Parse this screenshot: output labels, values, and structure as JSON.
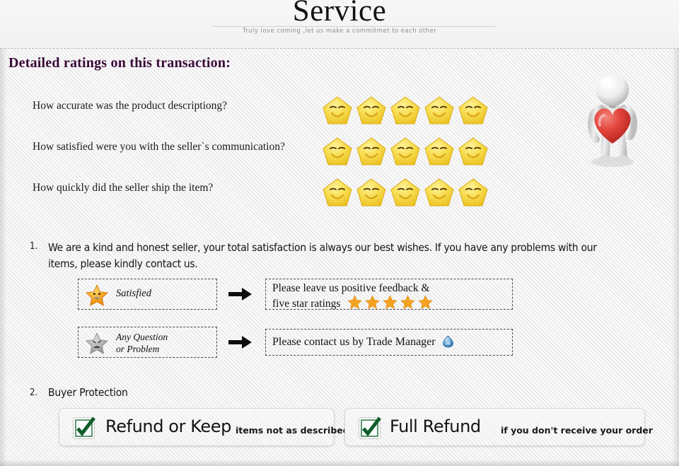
{
  "header": {
    "title": "Service",
    "subtitle": "Truly love coming ,let us make a commitmet to each other"
  },
  "ratings": {
    "heading": "Detailed ratings on this transaction:",
    "rows": [
      {
        "question": "How accurate was the product descriptiong?",
        "stars": 5,
        "star_icon": "smiling-star-icon"
      },
      {
        "question": "How satisfied were you with the seller`s communication?",
        "stars": 5,
        "star_icon": "smiling-star-icon"
      },
      {
        "question": "How quickly did the seller ship the item?",
        "stars": 5,
        "star_icon": "smiling-star-icon"
      }
    ]
  },
  "list": {
    "item1_number": "1.",
    "item1_text": "We are a kind and honest seller, your total satisfaction is always our best wishes. If you have any problems with our items, please kindly contact us.",
    "item2_number": "2.",
    "item2_text": "Buyer Protection"
  },
  "flows": [
    {
      "left_icon": "happy-star-icon",
      "left_label": "Satisfied",
      "arrow_icon": "arrow-right-icon",
      "right_line1": "Please leave us positive feedback &",
      "right_line2": "five star ratings",
      "right_stars": 5,
      "right_star_icon": "gold-star-icon"
    },
    {
      "left_icon": "sad-star-icon",
      "left_label_line1": "Any Question",
      "left_label_line2": "or Problem",
      "arrow_icon": "arrow-right-icon",
      "right_text": "Please contact us by Trade Manager",
      "right_icon": "trade-manager-icon"
    }
  ],
  "protection": [
    {
      "icon": "green-checkmark-icon",
      "main": "Refund or Keep",
      "sub": "items not as described"
    },
    {
      "icon": "green-checkmark-icon",
      "main": "Full Refund",
      "sub": "if you don't receive your order"
    }
  ],
  "decor": {
    "mannequin": "3d-figure-holding-heart-icon"
  },
  "colors": {
    "heading": "#3b0a38",
    "star_yellow": "#f3d13f",
    "star_gold": "#f0a020",
    "star_gray": "#9a9a9a",
    "check_green": "#14713a",
    "heart_red": "#e23b32",
    "background": "#efefef",
    "tm_blue": "#4d9ed6"
  }
}
